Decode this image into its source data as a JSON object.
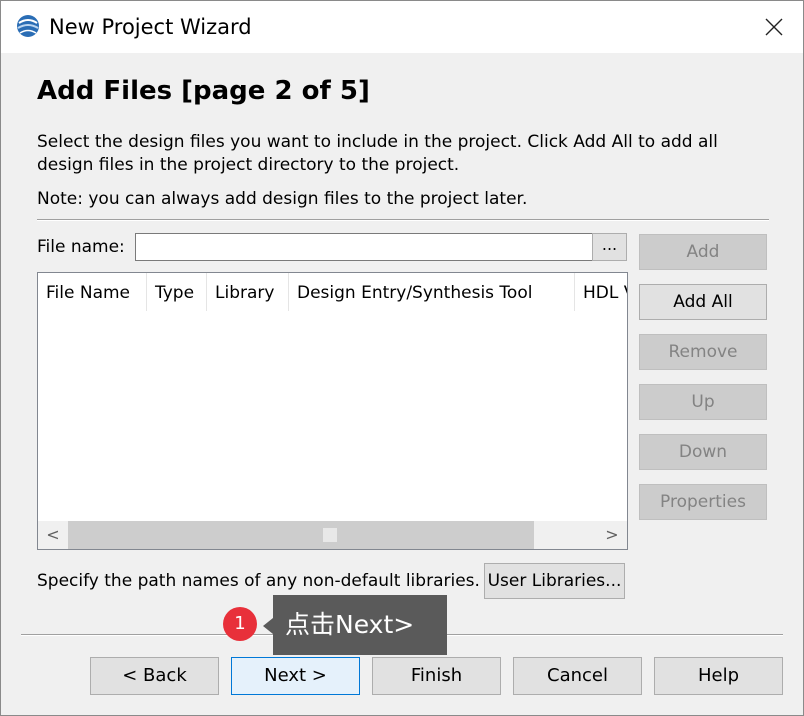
{
  "window": {
    "title": "New Project Wizard",
    "app_icon": "quartus-globe-icon",
    "close_icon": "close-icon"
  },
  "page": {
    "heading": "Add Files [page 2 of 5]",
    "description": "Select the design files you want to include in the project. Click Add All to add all design files in the project directory to the project.",
    "note": "Note: you can always add design files to the project later."
  },
  "file_name": {
    "label": "File name:",
    "value": "",
    "browse_label": "..."
  },
  "table": {
    "columns": [
      "File Name",
      "Type",
      "Library",
      "Design Entry/Synthesis Tool",
      "HDL Version"
    ],
    "rows": [],
    "scroll_left": "<",
    "scroll_right": ">"
  },
  "side_buttons": {
    "add": "Add",
    "add_all": "Add All",
    "remove": "Remove",
    "up": "Up",
    "down": "Down",
    "properties": "Properties"
  },
  "libraries": {
    "label": "Specify the path names of any non-default libraries.",
    "button": "User Libraries..."
  },
  "annotation": {
    "badge": "1",
    "tooltip": "点击Next>",
    "colors": {
      "badge": "#e8303a",
      "tooltip_bg": "#5a5a5a"
    }
  },
  "footer": {
    "back": "< Back",
    "next": "Next >",
    "finish": "Finish",
    "cancel": "Cancel",
    "help": "Help"
  }
}
